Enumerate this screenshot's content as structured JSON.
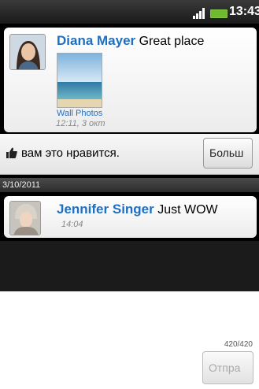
{
  "status_bar": {
    "time": "13:43"
  },
  "feed": {
    "posts": [
      {
        "author": "Diana Mayer",
        "text": "Great place",
        "attachment_link": "Wall Photos",
        "timestamp": "12:11, 3 окт"
      },
      {
        "author": "Jennifer Singer",
        "text": "Just WOW",
        "timestamp": "14:04"
      }
    ],
    "like_text": "вам это нравится.",
    "more_button": "Больш",
    "date_separator": "3/10/2011"
  },
  "compose": {
    "value": "",
    "counter": "420/420",
    "send_button": "Отпра"
  }
}
